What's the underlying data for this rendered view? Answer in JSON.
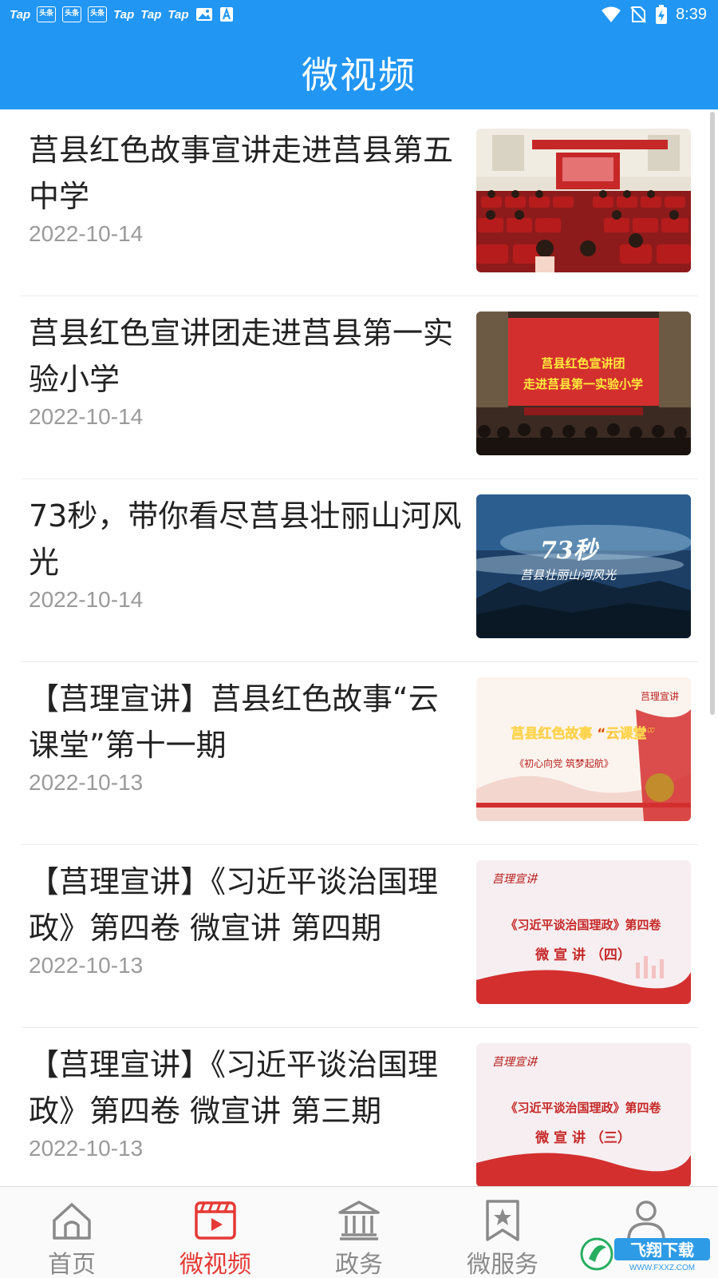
{
  "status_bar": {
    "time": "8:39",
    "notification_icons": [
      "Tap",
      "头条",
      "头条",
      "头条",
      "Tap",
      "Tap",
      "Tap"
    ],
    "icon_names": [
      "image-notification-icon",
      "a-notification-icon",
      "wifi-icon",
      "sim-no-signal-icon",
      "battery-charging-icon"
    ]
  },
  "header": {
    "title": "微视频"
  },
  "colors": {
    "primary": "#2196f3",
    "active_tab": "#e53935",
    "inactive_tab": "#8a8a8a",
    "date": "#9a9a9a"
  },
  "videos": [
    {
      "title": "莒县红色故事宣讲走进莒县第五中学",
      "date": "2022-10-14",
      "thumb": "auditorium-banner"
    },
    {
      "title": "莒县红色宣讲团走进莒县第一实验小学",
      "date": "2022-10-14",
      "thumb": "stage-red-screen",
      "thumb_text": [
        "莒县红色宣讲团",
        "走进莒县第一实验小学"
      ]
    },
    {
      "title": "73秒，带你看尽莒县壮丽山河风光",
      "date": "2022-10-14",
      "thumb": "mountain-scenery",
      "thumb_text": [
        "73秒",
        "莒县壮丽山河风光"
      ]
    },
    {
      "title": "【莒理宣讲】莒县红色故事“云课堂”第十一期",
      "date": "2022-10-13",
      "thumb": "red-story-poster",
      "thumb_text": [
        "莒理宣讲",
        "莒县红色故事 “云课堂”",
        "《初心向党 筑梦起航》"
      ]
    },
    {
      "title": "【莒理宣讲】《习近平谈治国理政》第四卷 微宣讲 第四期",
      "date": "2022-10-13",
      "thumb": "red-banner-poster",
      "thumb_text": [
        "莒理宣讲",
        "《习近平谈治国理政》第四卷",
        "微 宣 讲 （四）"
      ]
    },
    {
      "title": "【莒理宣讲】《习近平谈治国理政》第四卷 微宣讲 第三期",
      "date": "2022-10-13",
      "thumb": "red-banner-poster",
      "thumb_text": [
        "莒理宣讲",
        "《习近平谈治国理政》第四卷",
        "微 宣 讲 （三）"
      ]
    }
  ],
  "tabs": [
    {
      "label": "首页",
      "icon": "home-icon",
      "active": false
    },
    {
      "label": "微视频",
      "icon": "video-clapper-icon",
      "active": true
    },
    {
      "label": "政务",
      "icon": "government-building-icon",
      "active": false
    },
    {
      "label": "微服务",
      "icon": "bookmark-star-icon",
      "active": false
    },
    {
      "label": "",
      "icon": "user-icon",
      "active": false
    }
  ],
  "watermark": {
    "text": "飞翔下载",
    "url_text": "WWW.FXXZ.COM"
  }
}
